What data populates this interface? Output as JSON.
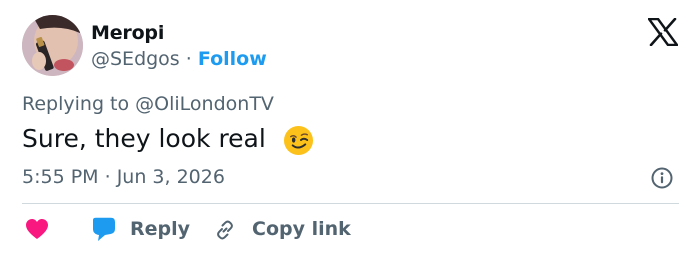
{
  "tweet": {
    "display_name": "Meropi",
    "handle": "@SEdgos",
    "separator": "·",
    "follow_label": "Follow",
    "replying_prefix": "Replying to",
    "replying_handle": "@OliLondonTV",
    "text": "Sure, they look real",
    "emoji": "winking-face-emoji",
    "time": "5:55 PM",
    "date": "Jun 3, 2026"
  },
  "actions": {
    "like_icon": "heart-icon",
    "reply_icon": "speech-bubble-icon",
    "reply_label": "Reply",
    "copy_icon": "link-icon",
    "copy_label": "Copy link"
  },
  "brand": {
    "logo": "x-logo-icon"
  },
  "colors": {
    "link": "#1d9bf0",
    "secondary_text": "#536471",
    "heart": "#f91880",
    "reply_bubble": "#1d9bf0"
  }
}
